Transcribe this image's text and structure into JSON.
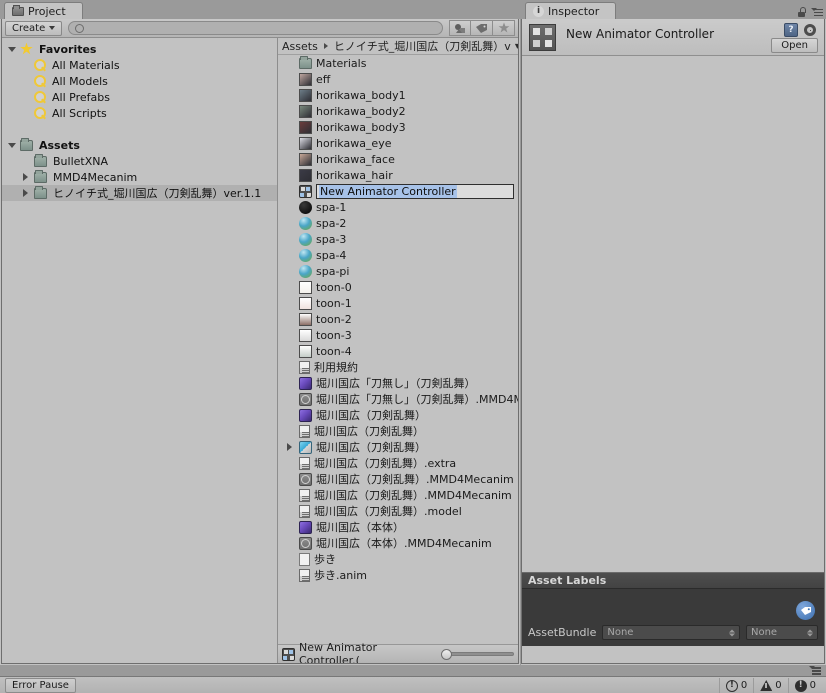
{
  "project": {
    "tab_label": "Project",
    "tab_icon": "folder-icon",
    "create_label": "Create",
    "search_placeholder": "",
    "search_value": "",
    "filter_icons": [
      "asset-type-filter-icon",
      "label-filter-icon",
      "favorite-filter-icon"
    ],
    "tree": [
      {
        "label": "Favorites",
        "icon": "star-icon",
        "depth": 0,
        "twisty": "down",
        "bold": true,
        "selected": false
      },
      {
        "label": "All Materials",
        "icon": "search-saved-icon",
        "depth": 1,
        "twisty": "none",
        "bold": false,
        "selected": false
      },
      {
        "label": "All Models",
        "icon": "search-saved-icon",
        "depth": 1,
        "twisty": "none",
        "bold": false,
        "selected": false
      },
      {
        "label": "All Prefabs",
        "icon": "search-saved-icon",
        "depth": 1,
        "twisty": "none",
        "bold": false,
        "selected": false
      },
      {
        "label": "All Scripts",
        "icon": "search-saved-icon",
        "depth": 1,
        "twisty": "none",
        "bold": false,
        "selected": false
      },
      {
        "label": "",
        "icon": "none",
        "depth": 0,
        "twisty": "none",
        "bold": false,
        "selected": false
      },
      {
        "label": "Assets",
        "icon": "folder-icon",
        "depth": 0,
        "twisty": "down",
        "bold": true,
        "selected": false
      },
      {
        "label": "BulletXNA",
        "icon": "folder-icon",
        "depth": 1,
        "twisty": "none",
        "bold": false,
        "selected": false
      },
      {
        "label": "MMD4Mecanim",
        "icon": "folder-icon",
        "depth": 1,
        "twisty": "right",
        "bold": false,
        "selected": false
      },
      {
        "label": "ヒノイチ式_堀川国広（刀剣乱舞）ver.1.1",
        "icon": "folder-icon",
        "depth": 1,
        "twisty": "right",
        "bold": false,
        "selected": true
      }
    ],
    "breadcrumb": {
      "root": "Assets",
      "current": "ヒノイチ式_堀川国広（刀剣乱舞）v",
      "caret": "▾"
    },
    "items": [
      {
        "label": "Materials",
        "icon": "folder-icon",
        "twisty": "none",
        "renaming": false
      },
      {
        "label": "eff",
        "icon": "texture-thumb-icon",
        "twisty": "none",
        "renaming": false,
        "color": "#bfa6a0"
      },
      {
        "label": "horikawa_body1",
        "icon": "texture-thumb-icon",
        "twisty": "none",
        "renaming": false,
        "color": "#6d7d88"
      },
      {
        "label": "horikawa_body2",
        "icon": "texture-thumb-icon",
        "twisty": "none",
        "renaming": false,
        "color": "#7a8a7e"
      },
      {
        "label": "horikawa_body3",
        "icon": "texture-thumb-icon",
        "twisty": "none",
        "renaming": false,
        "color": "#6b3c3c"
      },
      {
        "label": "horikawa_eye",
        "icon": "texture-thumb-icon",
        "twisty": "none",
        "renaming": false,
        "color": "#dcdce4"
      },
      {
        "label": "horikawa_face",
        "icon": "texture-thumb-icon",
        "twisty": "none",
        "renaming": false,
        "color": "#c8a898"
      },
      {
        "label": "horikawa_hair",
        "icon": "texture-thumb-icon",
        "twisty": "none",
        "renaming": false,
        "color": "#3b3b46"
      },
      {
        "label": "New Animator Controller",
        "icon": "animator-controller-icon",
        "twisty": "none",
        "renaming": true
      },
      {
        "label": "spa-1",
        "icon": "sphere-icon",
        "twisty": "none",
        "renaming": false,
        "color": "#0b0b0b"
      },
      {
        "label": "spa-2",
        "icon": "sphere-icon",
        "twisty": "none",
        "renaming": false,
        "color": "#57a8c6"
      },
      {
        "label": "spa-3",
        "icon": "sphere-icon",
        "twisty": "none",
        "renaming": false,
        "color": "#57a8c6"
      },
      {
        "label": "spa-4",
        "icon": "sphere-icon",
        "twisty": "none",
        "renaming": false,
        "color": "#57a8c6"
      },
      {
        "label": "spa-pi",
        "icon": "sphere-icon",
        "twisty": "none",
        "renaming": false,
        "color": "#57a8c6"
      },
      {
        "label": "toon-0",
        "icon": "gradient-swatch-icon",
        "twisty": "none",
        "renaming": false,
        "color": "#f4f1ec"
      },
      {
        "label": "toon-1",
        "icon": "gradient-swatch-icon",
        "twisty": "none",
        "renaming": false,
        "color": "#f0e2de"
      },
      {
        "label": "toon-2",
        "icon": "gradient-swatch-icon",
        "twisty": "none",
        "renaming": false,
        "color": "#8c6f66"
      },
      {
        "label": "toon-3",
        "icon": "gradient-swatch-icon",
        "twisty": "none",
        "renaming": false,
        "color": "#d9d9d9"
      },
      {
        "label": "toon-4",
        "icon": "gradient-swatch-icon",
        "twisty": "none",
        "renaming": false,
        "color": "#c4cdc8"
      },
      {
        "label": "利用規約",
        "icon": "text-document-icon",
        "twisty": "none",
        "renaming": false
      },
      {
        "label": "堀川国広「刀無し」（刀剣乱舞）",
        "icon": "model-icon",
        "twisty": "none",
        "renaming": false
      },
      {
        "label": "堀川国広「刀無し」（刀剣乱舞）.MMD4M",
        "icon": "script-asset-icon",
        "twisty": "none",
        "renaming": false
      },
      {
        "label": "堀川国広（刀剣乱舞）",
        "icon": "model-icon",
        "twisty": "none",
        "renaming": false
      },
      {
        "label": "堀川国広（刀剣乱舞）",
        "icon": "text-document-icon",
        "twisty": "none",
        "renaming": false
      },
      {
        "label": "堀川国広（刀剣乱舞）",
        "icon": "prefab-icon",
        "twisty": "right",
        "renaming": false
      },
      {
        "label": "堀川国広（刀剣乱舞）.extra",
        "icon": "text-document-icon",
        "twisty": "none",
        "renaming": false
      },
      {
        "label": "堀川国広（刀剣乱舞）.MMD4Mecanim",
        "icon": "script-asset-icon",
        "twisty": "none",
        "renaming": false
      },
      {
        "label": "堀川国広（刀剣乱舞）.MMD4Mecanim",
        "icon": "text-document-icon",
        "twisty": "none",
        "renaming": false
      },
      {
        "label": "堀川国広（刀剣乱舞）.model",
        "icon": "text-document-icon",
        "twisty": "none",
        "renaming": false
      },
      {
        "label": "堀川国広（本体）",
        "icon": "model-icon",
        "twisty": "none",
        "renaming": false
      },
      {
        "label": "堀川国広（本体）.MMD4Mecanim",
        "icon": "script-asset-icon",
        "twisty": "none",
        "renaming": false
      },
      {
        "label": "歩き",
        "icon": "blank-page-icon",
        "twisty": "none",
        "renaming": false
      },
      {
        "label": "歩き.anim",
        "icon": "text-document-icon",
        "twisty": "none",
        "renaming": false
      }
    ],
    "footer": {
      "icon": "animator-controller-icon",
      "selected_path": "New Animator Controller.(",
      "zoom_value": 0
    }
  },
  "inspector": {
    "tab_label": "Inspector",
    "tab_icon": "info-icon",
    "lock_icon": "lock-icon",
    "menu_icon": "hamburger-menu-icon",
    "asset_name": "New Animator Controller",
    "asset_icon": "animator-controller-icon",
    "help_icon": "help-icon",
    "settings_icon": "gear-icon",
    "open_label": "Open",
    "asset_labels": {
      "header": "Asset Labels",
      "tag_icon": "label-tag-icon",
      "bundle_label": "AssetBundle",
      "bundle_value": "None",
      "variant_value": "None"
    }
  },
  "statusbar": {
    "error_pause_label": "Error Pause",
    "counters": [
      {
        "icon": "error-icon",
        "count": "0"
      },
      {
        "icon": "warning-icon",
        "count": "0"
      },
      {
        "icon": "info-icon",
        "count": "0"
      }
    ],
    "menu_icon": "hamburger-menu-icon"
  }
}
